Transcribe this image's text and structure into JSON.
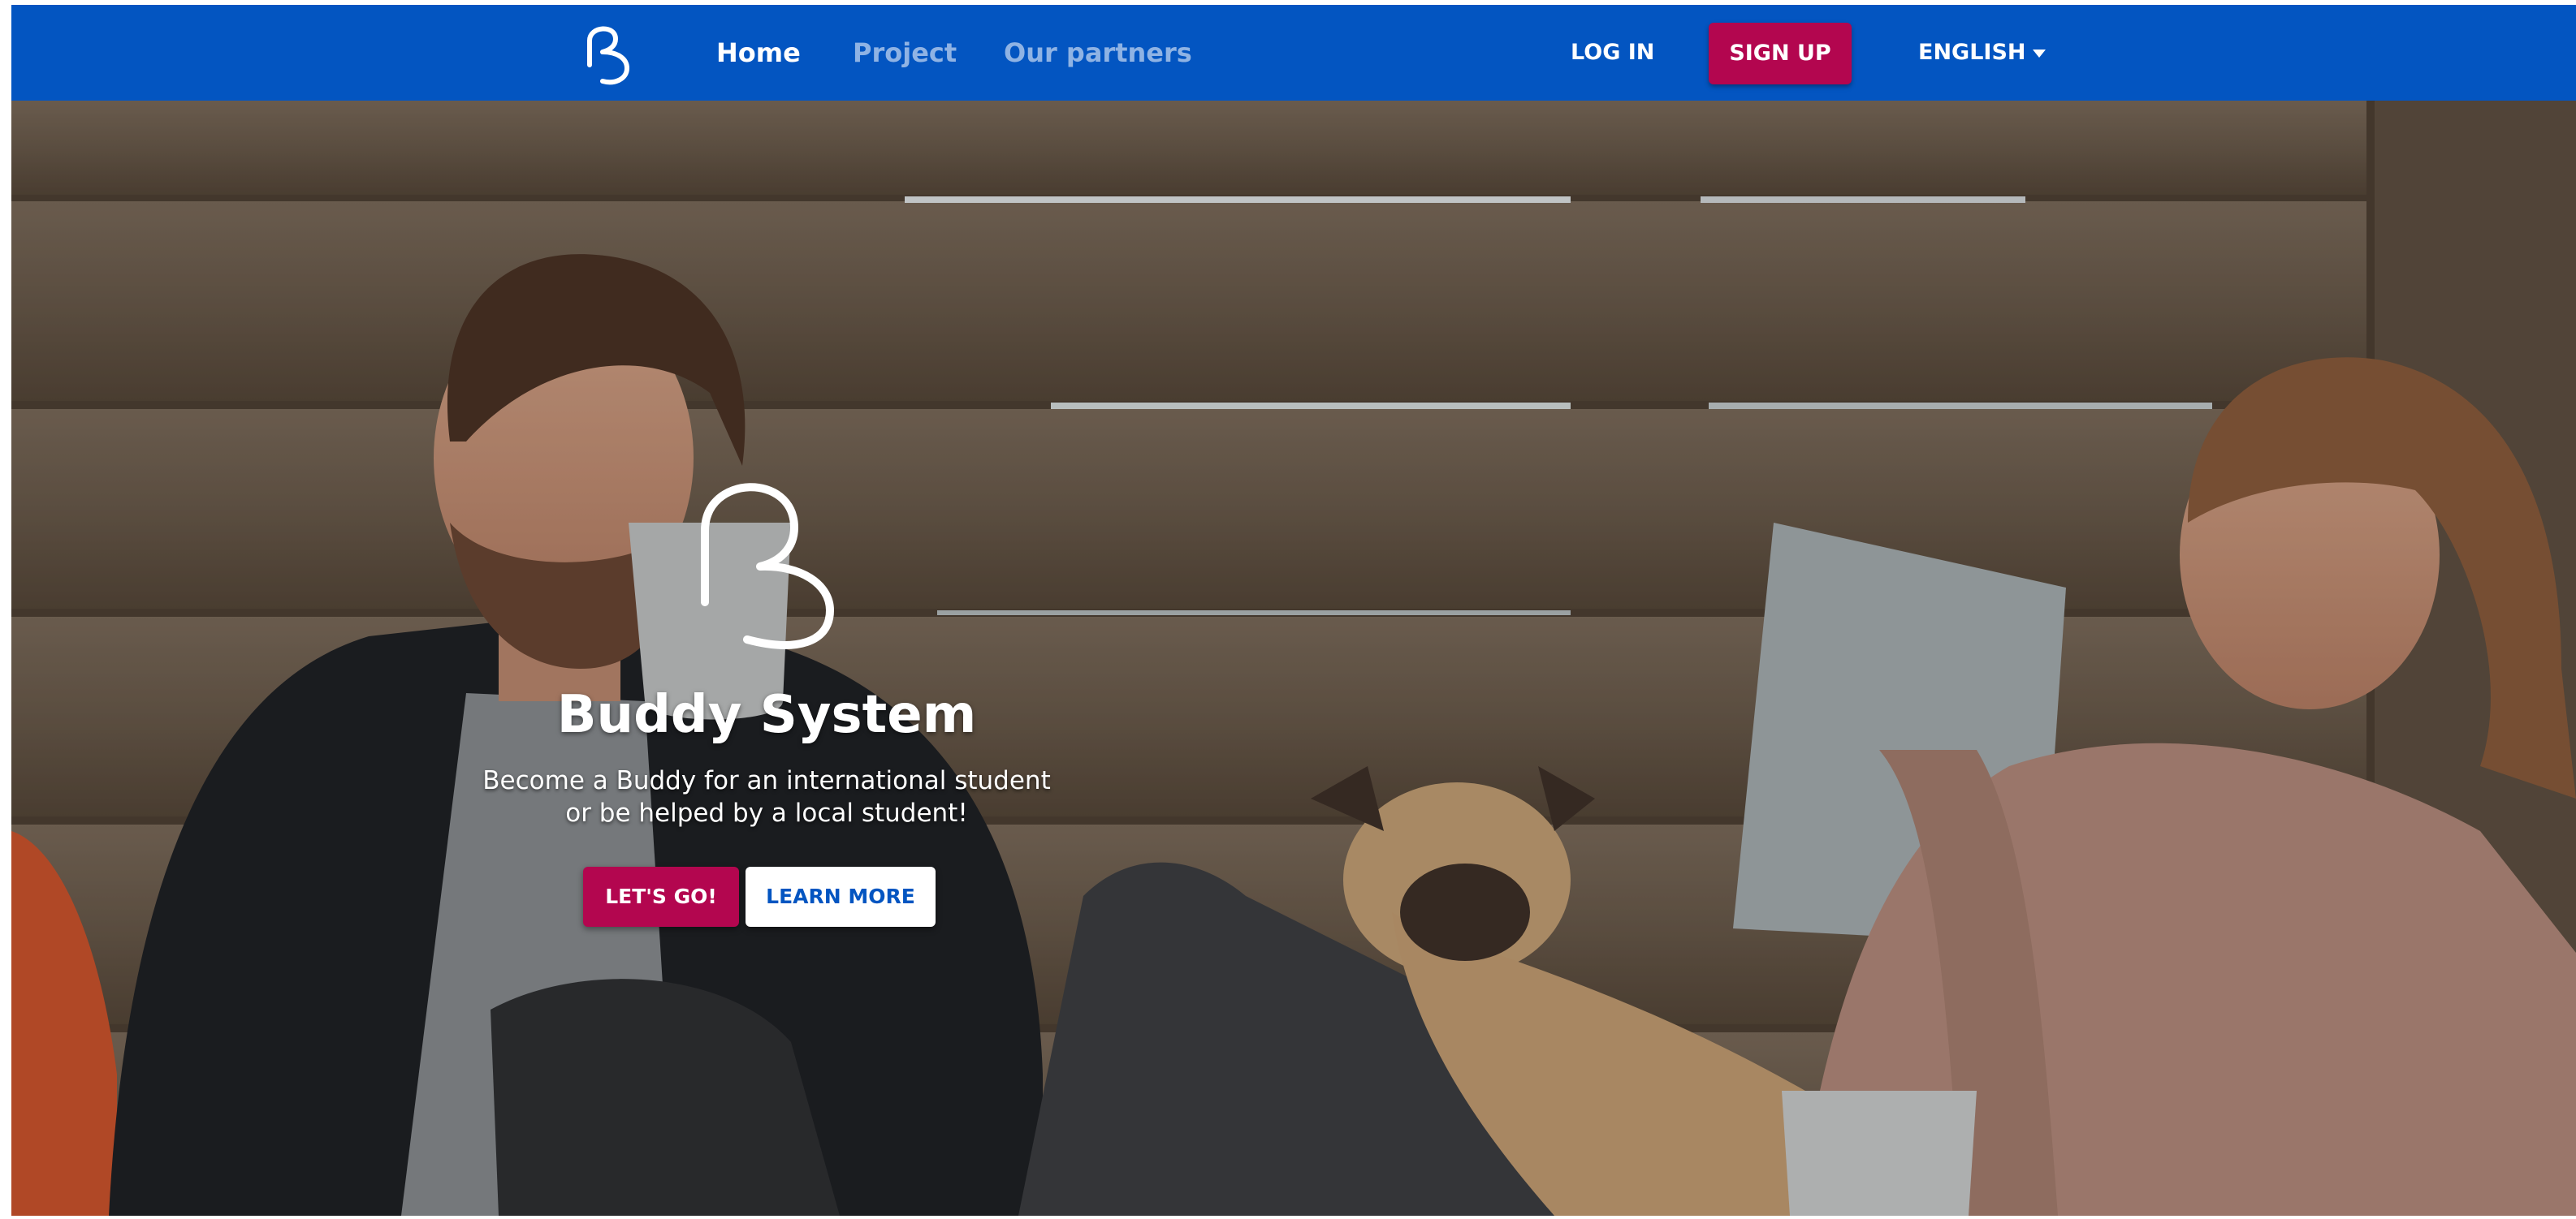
{
  "nav": {
    "links": [
      {
        "label": "Home",
        "active": true
      },
      {
        "label": "Project",
        "active": false
      },
      {
        "label": "Our partners",
        "active": false
      }
    ],
    "login_label": "LOG IN",
    "signup_label": "SIGN UP",
    "language_label": "ENGLISH",
    "language_icon": "caret-down-icon",
    "logo_icon": "buddy-logo-icon"
  },
  "hero": {
    "title": "Buddy System",
    "subtitle_line1": "Become a Buddy for an international student",
    "subtitle_line2": "or be helped by a local student!",
    "primary_cta": "LET'S GO!",
    "secondary_cta": "LEARN MORE",
    "background_image": "photo of two people with mugs and a pug on a wooden deck"
  },
  "colors": {
    "nav_bg": "#0355c1",
    "nav_inactive": "#8fb3e4",
    "accent": "#b3064f",
    "white": "#ffffff"
  }
}
